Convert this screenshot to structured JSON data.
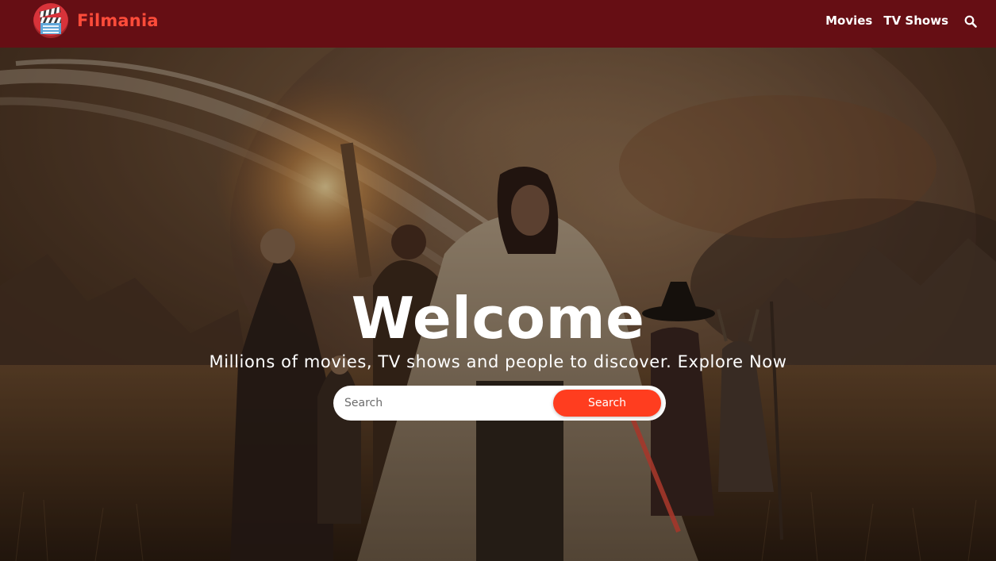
{
  "brand": {
    "name": "Filmania",
    "logo_icon": "clapperboard-icon",
    "accent_color": "#ff4c3a"
  },
  "header": {
    "background_color": "#660e14",
    "nav": [
      {
        "label": "Movies"
      },
      {
        "label": "TV Shows"
      }
    ],
    "search_icon": "search-icon"
  },
  "hero": {
    "title": "Welcome",
    "tagline": "Millions of movies, TV shows and people to discover. Explore Now",
    "search": {
      "placeholder": "Search",
      "value": "",
      "button_label": "Search",
      "button_color": "#ff3d1f"
    }
  }
}
